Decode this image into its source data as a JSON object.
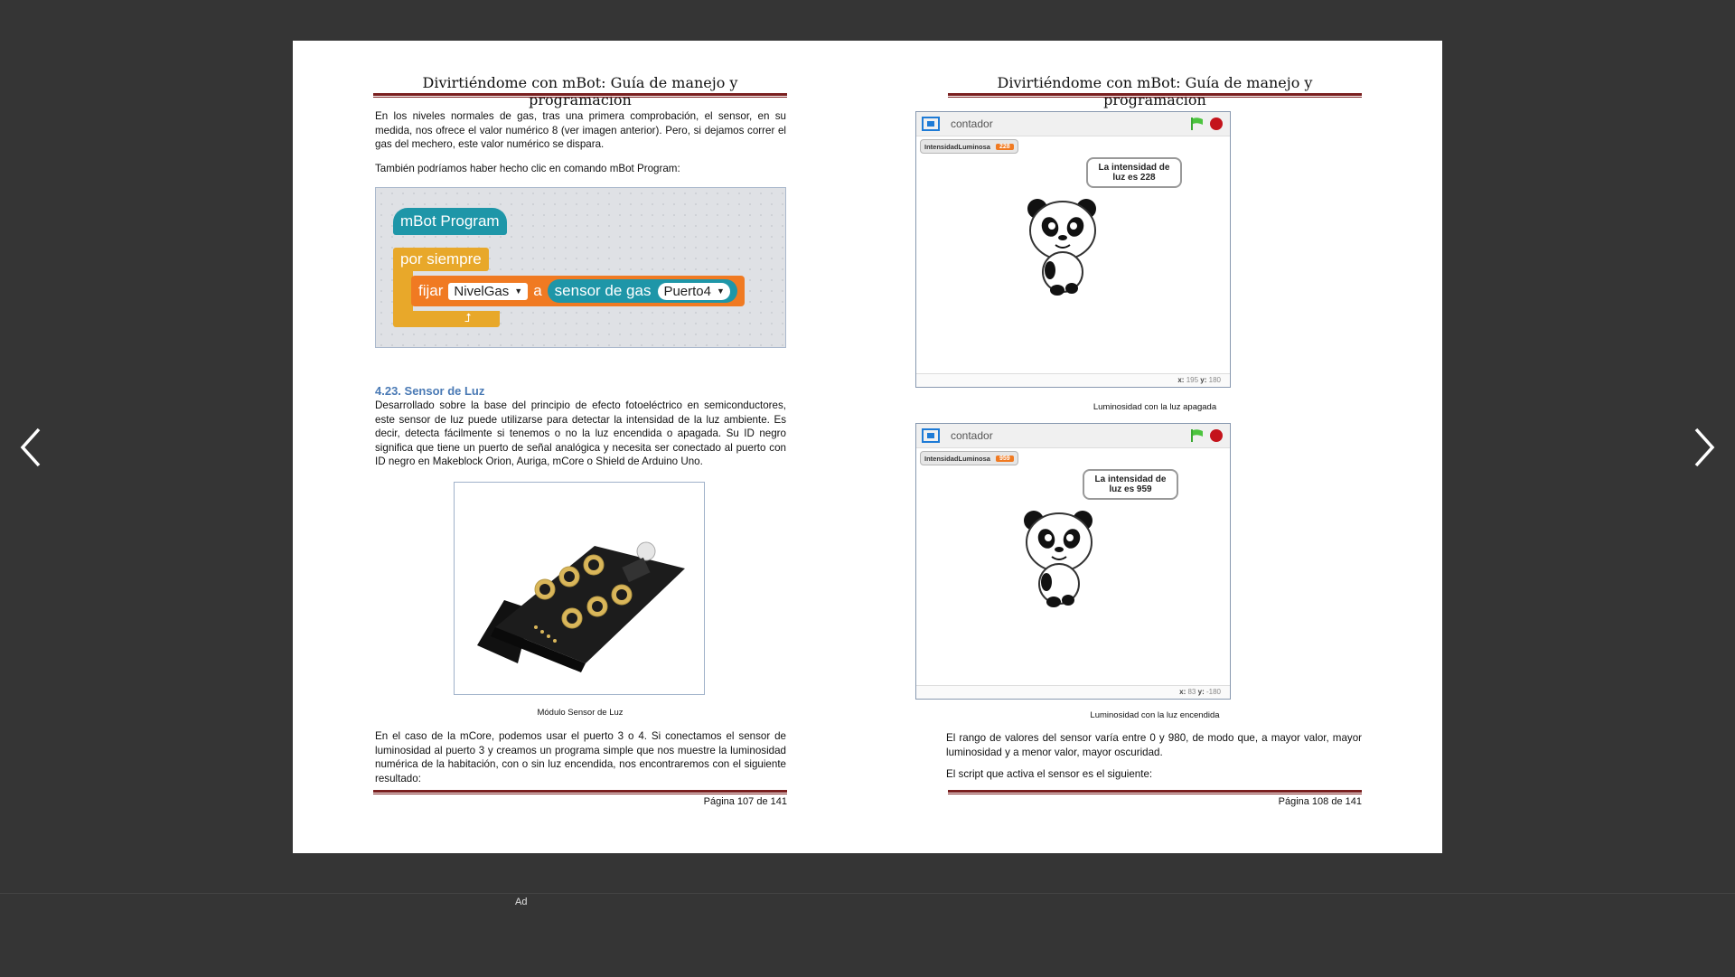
{
  "nav": {
    "prev_icon": "chevron-left-icon",
    "next_icon": "chevron-right-icon"
  },
  "left_page": {
    "header": "Divirtiéndome con mBot: Guía de manejo y programación",
    "para1": "En los niveles normales de gas, tras una primera comprobación, el sensor, en su medida, nos ofrece el valor numérico 8 (ver imagen anterior). Pero, si dejamos correr el gas del mechero, este valor numérico se dispara.",
    "para2": "También podríamos haber hecho clic en comando mBot Program:",
    "blocks": {
      "hat": "mBot Program",
      "loop": "por siempre",
      "set": "fijar",
      "variable": "NivelGas",
      "to": "a",
      "reporter": "sensor de gas",
      "port": "Puerto4"
    },
    "section_heading": "4.23. Sensor de Luz",
    "para3": "Desarrollado sobre la base del principio de efecto fotoeléctrico en semiconductores, este sensor de luz puede utilizarse para detectar la intensidad de la luz ambiente. Es decir, detecta fácilmente si tenemos o no la luz encendida o apagada. Su ID negro significa que tiene un puerto de señal analógica y necesita ser conectado al puerto con ID negro en Makeblock Orion, Auriga, mCore o Shield de Arduino Uno.",
    "photo_caption": "Módulo Sensor de Luz",
    "para4": "En el caso de la mCore, podemos usar el puerto 3 o 4. Si conectamos el sensor de luminosidad al puerto 3 y creamos un programa simple que nos muestre la luminosidad numérica de la habitación, con o sin luz encendida, nos encontraremos con el siguiente resultado:",
    "page_number": "Página 107 de 141"
  },
  "right_page": {
    "header": "Divirtiéndome con mBot: Guía de manejo y programación",
    "stage1": {
      "title": "contador",
      "monitor_label": "IntensidadLuminosa",
      "monitor_value": "228",
      "bubble": "La intensidad de luz es 228",
      "x_label": "x:",
      "x_value": "195",
      "y_label": "y:",
      "y_value": "180"
    },
    "caption1": "Luminosidad con la luz apagada",
    "stage2": {
      "title": "contador",
      "monitor_label": "IntensidadLuminosa",
      "monitor_value": "959",
      "bubble": "La intensidad de luz es 959",
      "x_label": "x:",
      "x_value": "83",
      "y_label": "y:",
      "y_value": "-180"
    },
    "caption2": "Luminosidad con la luz encendida",
    "para1": "El rango de valores del sensor varía entre 0 y 980, de modo que, a mayor valor, mayor luminosidad y a menor valor, mayor oscuridad.",
    "para2": "El script que activa el sensor es el siguiente:",
    "page_number": "Página 108 de 141"
  },
  "ad_label": "Ad",
  "colors": {
    "background": "#353535",
    "rule": "#7a1f1f",
    "heading": "#4a7ab5",
    "block_teal": "#1e96a8",
    "block_orange": "#f07a22",
    "block_yellow": "#e8a82a"
  }
}
